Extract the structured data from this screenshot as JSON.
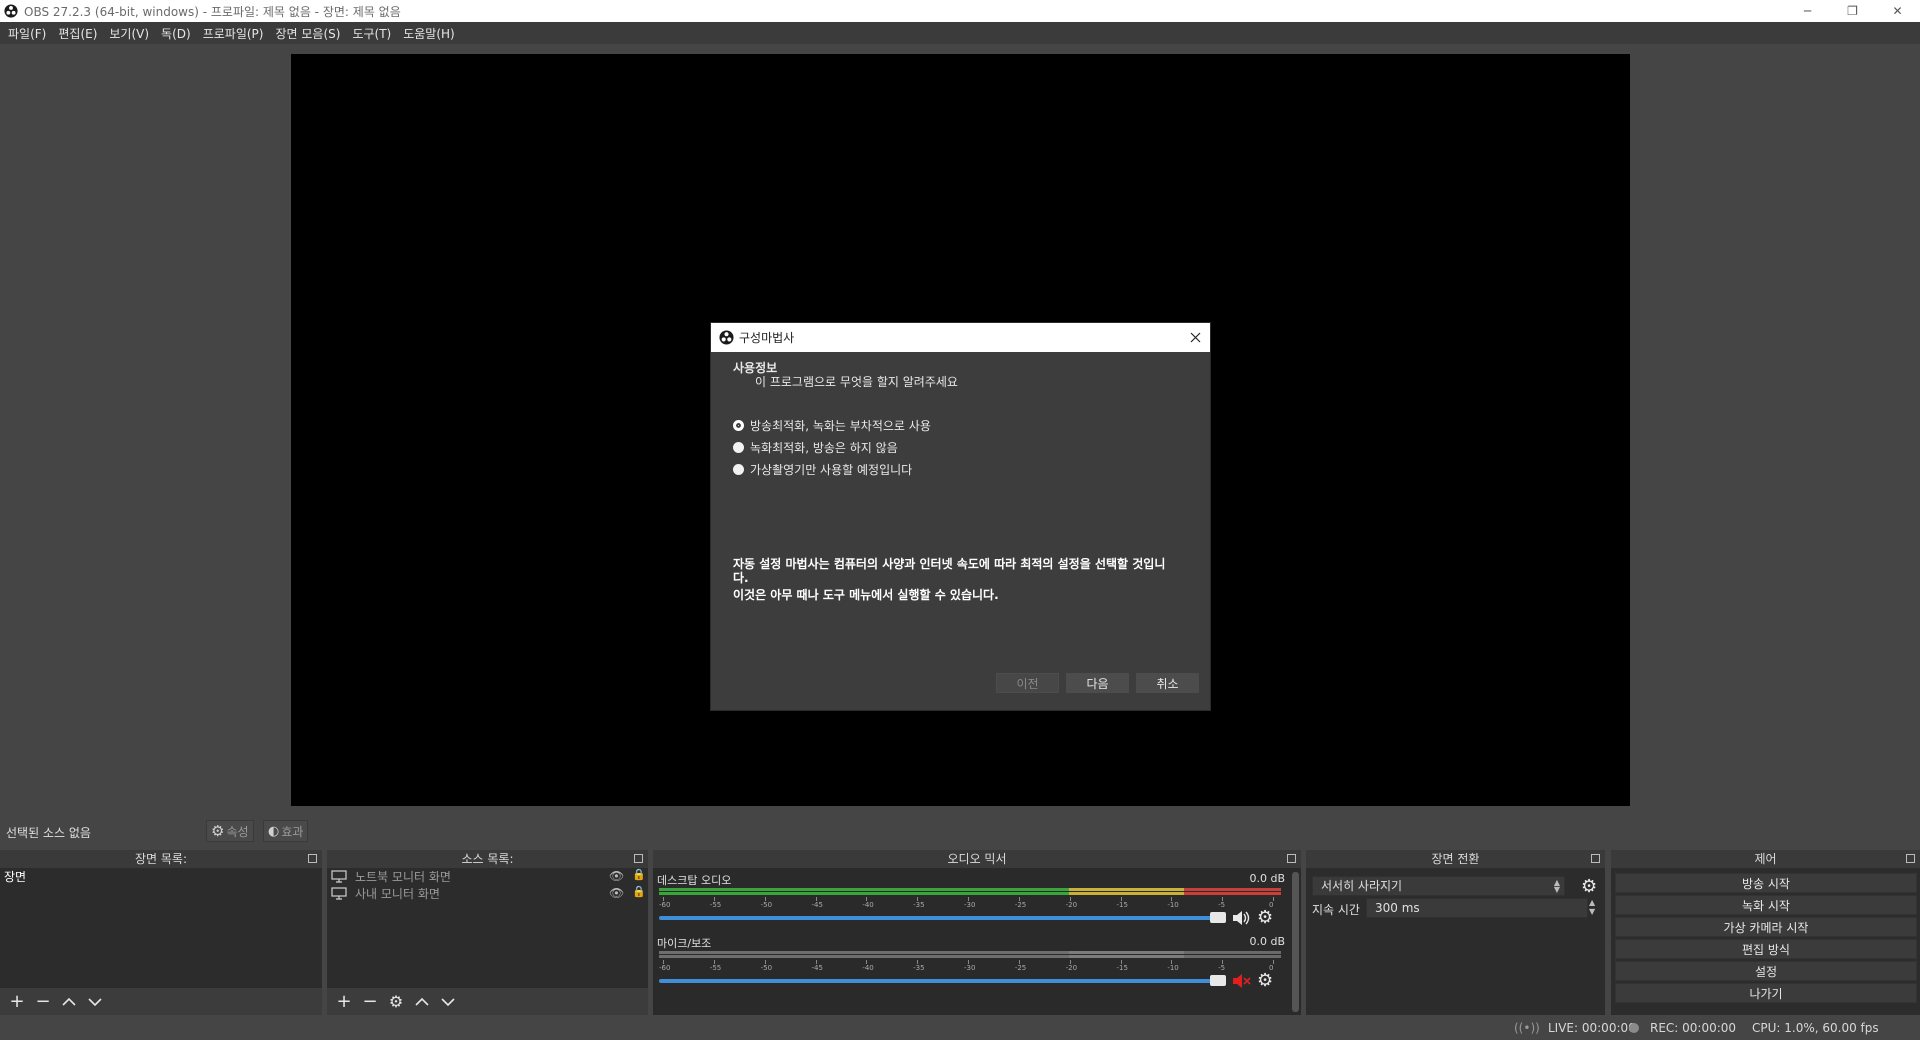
{
  "window": {
    "title": "OBS 27.2.3 (64-bit, windows) - 프로파일: 제목 없음 - 장면: 제목 없음",
    "minimize_icon": "─",
    "restore_icon": "❐",
    "close_icon": "✕"
  },
  "menu": [
    {
      "label": "파일(F)"
    },
    {
      "label": "편집(E)"
    },
    {
      "label": "보기(V)"
    },
    {
      "label": "독(D)"
    },
    {
      "label": "프로파일(P)"
    },
    {
      "label": "장면 모음(S)"
    },
    {
      "label": "도구(T)"
    },
    {
      "label": "도움말(H)"
    }
  ],
  "dialog": {
    "title": "구성마법사",
    "heading": "사용정보",
    "subheading": "이 프로그램으로 무엇을 할지 알려주세요",
    "options": [
      {
        "label": "방송최적화, 녹화는 부차적으로 사용",
        "selected": true
      },
      {
        "label": "녹화최적화, 방송은 하지 않음",
        "selected": false
      },
      {
        "label": "가상촬영기만 사용할 예정입니다",
        "selected": false
      }
    ],
    "info_line1": "자동 설정 마법사는 컴퓨터의 사양과 인터넷 속도에 따라 최적의 설정을 선택할 것입니다.",
    "info_line2": "이것은 아무 때나 도구 메뉴에서 실행할 수 있습니다.",
    "prev_label": "이전",
    "next_label": "다음",
    "cancel_label": "취소"
  },
  "selection": {
    "no_source_text": "선택된 소스 없음",
    "properties_label": "속성",
    "filters_label": "효과"
  },
  "scenes": {
    "header": "장면 목록:",
    "items": [
      {
        "label": "장면"
      }
    ]
  },
  "sources": {
    "header": "소스 목록:",
    "items": [
      {
        "label": "노트북 모니터 화면"
      },
      {
        "label": "사내 모니터 화면"
      }
    ]
  },
  "mixer": {
    "header": "오디오 믹서",
    "ticks": [
      "-60",
      "-55",
      "-50",
      "-45",
      "-40",
      "-35",
      "-30",
      "-25",
      "-20",
      "-15",
      "-10",
      "-5",
      "0"
    ],
    "channels": [
      {
        "name": "데스크탑 오디오",
        "db": "0.0 dB",
        "muted": false,
        "volume": 1.0
      },
      {
        "name": "마이크/보조",
        "db": "0.0 dB",
        "muted": true,
        "volume": 1.0
      }
    ]
  },
  "transitions": {
    "header": "장면 전환",
    "selected": "서서히 사라지기",
    "duration_label": "지속 시간",
    "duration_value": "300 ms"
  },
  "controls": {
    "header": "제어",
    "buttons": [
      {
        "label": "방송 시작"
      },
      {
        "label": "녹화 시작"
      },
      {
        "label": "가상 카메라 시작"
      },
      {
        "label": "편집 방식"
      },
      {
        "label": "설정"
      },
      {
        "label": "나가기"
      }
    ]
  },
  "status": {
    "live": "LIVE: 00:00:00",
    "rec": "REC: 00:00:00",
    "cpu": "CPU: 1.0%, 60.00 fps"
  },
  "colors": {
    "meter_green": "#3aa53a",
    "meter_yellow": "#c9b23a",
    "meter_red": "#c9403a",
    "slider_blue": "#3e8ed8",
    "mute_red": "#e02020"
  }
}
